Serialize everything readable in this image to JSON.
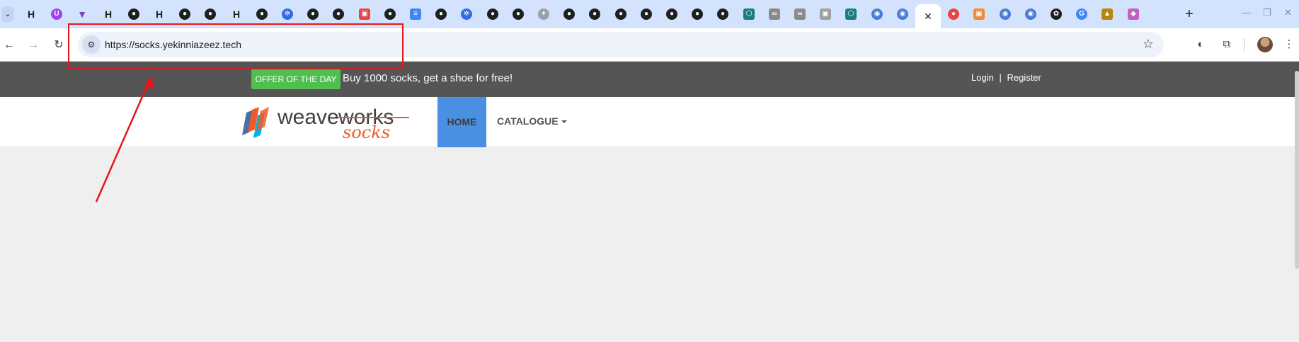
{
  "browser": {
    "tabs": [
      {
        "icon": "hashicorp-icon",
        "glyph": "H",
        "kind": "hashi",
        "color": "#1f1f1f"
      },
      {
        "icon": "purple-circle-icon",
        "glyph": "U",
        "kind": "round",
        "color": "#a142f4"
      },
      {
        "icon": "terraform-icon",
        "glyph": "▼",
        "kind": "hashi",
        "color": "#7b42bc"
      },
      {
        "icon": "hashicorp-icon",
        "glyph": "H",
        "kind": "hashi",
        "color": "#1f1f1f"
      },
      {
        "icon": "github-icon",
        "glyph": "●",
        "kind": "gh",
        "color": "#1f1f1f"
      },
      {
        "icon": "hashicorp-icon",
        "glyph": "H",
        "kind": "hashi",
        "color": "#1f1f1f"
      },
      {
        "icon": "github-icon",
        "glyph": "●",
        "kind": "gh",
        "color": "#1f1f1f"
      },
      {
        "icon": "github-icon",
        "glyph": "●",
        "kind": "gh",
        "color": "#1f1f1f"
      },
      {
        "icon": "hashicorp-icon",
        "glyph": "H",
        "kind": "hashi",
        "color": "#1f1f1f"
      },
      {
        "icon": "github-icon",
        "glyph": "●",
        "kind": "gh",
        "color": "#1f1f1f"
      },
      {
        "icon": "kubernetes-icon",
        "glyph": "✲",
        "kind": "k8s",
        "color": "#326ce5"
      },
      {
        "icon": "github-icon",
        "glyph": "●",
        "kind": "gh",
        "color": "#1f1f1f"
      },
      {
        "icon": "github-icon",
        "glyph": "●",
        "kind": "gh",
        "color": "#1f1f1f"
      },
      {
        "icon": "red-box-icon",
        "glyph": "▣",
        "kind": "square",
        "color": "#e8453c"
      },
      {
        "icon": "github-icon",
        "glyph": "●",
        "kind": "gh",
        "color": "#1f1f1f"
      },
      {
        "icon": "google-docs-icon",
        "glyph": "≡",
        "kind": "square",
        "color": "#4285f4"
      },
      {
        "icon": "github-icon",
        "glyph": "●",
        "kind": "gh",
        "color": "#1f1f1f"
      },
      {
        "icon": "kubernetes-icon",
        "glyph": "✲",
        "kind": "k8s",
        "color": "#326ce5"
      },
      {
        "icon": "github-icon",
        "glyph": "●",
        "kind": "gh",
        "color": "#1f1f1f"
      },
      {
        "icon": "github-icon",
        "glyph": "●",
        "kind": "gh",
        "color": "#1f1f1f"
      },
      {
        "icon": "gray-star-icon",
        "glyph": "✦",
        "kind": "round",
        "color": "#9aa0a6"
      },
      {
        "icon": "github-icon",
        "glyph": "●",
        "kind": "gh",
        "color": "#1f1f1f"
      },
      {
        "icon": "github-icon",
        "glyph": "●",
        "kind": "gh",
        "color": "#1f1f1f"
      },
      {
        "icon": "github-icon",
        "glyph": "●",
        "kind": "gh",
        "color": "#1f1f1f"
      },
      {
        "icon": "github-icon",
        "glyph": "●",
        "kind": "gh",
        "color": "#1f1f1f"
      },
      {
        "icon": "github-icon",
        "glyph": "●",
        "kind": "gh",
        "color": "#1f1f1f"
      },
      {
        "icon": "github-icon",
        "glyph": "●",
        "kind": "gh",
        "color": "#1f1f1f"
      },
      {
        "icon": "github-icon",
        "glyph": "●",
        "kind": "gh",
        "color": "#1f1f1f"
      },
      {
        "icon": "hexagon-icon",
        "glyph": "⬡",
        "kind": "square",
        "color": "#1a7f7a"
      },
      {
        "icon": "link-icon",
        "glyph": "∞",
        "kind": "square",
        "color": "#8a8a8a"
      },
      {
        "icon": "link-icon",
        "glyph": "∞",
        "kind": "square",
        "color": "#8a8a8a"
      },
      {
        "icon": "gray-box-icon",
        "glyph": "▣",
        "kind": "square",
        "color": "#9e9e9e"
      },
      {
        "icon": "hexagon-icon",
        "glyph": "⬡",
        "kind": "square",
        "color": "#1a7f7a"
      },
      {
        "icon": "blue-circle-icon",
        "glyph": "◉",
        "kind": "round",
        "color": "#4a7bd8"
      },
      {
        "icon": "blue-circle-icon",
        "glyph": "◉",
        "kind": "round",
        "color": "#4a7bd8"
      },
      {
        "icon": "active-tab-close-icon",
        "glyph": "✕",
        "kind": "active",
        "color": "#1f1f1f"
      },
      {
        "icon": "microphone-icon",
        "glyph": "●",
        "kind": "round",
        "color": "#e8453c"
      },
      {
        "icon": "orange-box-icon",
        "glyph": "▣",
        "kind": "square",
        "color": "#f28b30"
      },
      {
        "icon": "blue-circle-icon",
        "glyph": "◉",
        "kind": "round",
        "color": "#4a7bd8"
      },
      {
        "icon": "blue-circle-icon",
        "glyph": "◉",
        "kind": "round",
        "color": "#4a7bd8"
      },
      {
        "icon": "openai-icon",
        "glyph": "✿",
        "kind": "gh",
        "color": "#1f1f1f"
      },
      {
        "icon": "google-icon",
        "glyph": "G",
        "kind": "round",
        "color": "#4285f4"
      },
      {
        "icon": "lock-box-icon",
        "glyph": "▲",
        "kind": "square",
        "color": "#b8860b"
      },
      {
        "icon": "cube-icon",
        "glyph": "◆",
        "kind": "square",
        "color": "#c060c0"
      }
    ],
    "url": "https://socks.yekinniazeez.tech",
    "icons": {
      "tab_list": "chevron-down-icon",
      "back": "back-arrow-icon",
      "forward": "forward-arrow-icon",
      "reload": "reload-icon",
      "site_info": "site-info-icon",
      "bookmark": "star-icon",
      "new_tab": "plus-icon",
      "extension_a": "extension-icon",
      "extensions": "puzzle-icon",
      "menu": "kebab-menu-icon"
    }
  },
  "page": {
    "offer_label": "OFFER OF THE DAY",
    "offer_text": "Buy 1000 socks, get a shoe for free!",
    "login": "Login",
    "separator": "|",
    "register": "Register",
    "logo": {
      "word1": "weave",
      "word2": "works",
      "word3": "socks"
    },
    "nav": {
      "home": "HOME",
      "catalogue": "CATALOGUE"
    }
  },
  "colors": {
    "tabstrip": "#d3e3fd",
    "topbar": "#555555",
    "offer_green": "#4fbf4f",
    "home_blue": "#4a90e2",
    "annotation_red": "#e8141a",
    "logo_orange": "#f05a28"
  }
}
